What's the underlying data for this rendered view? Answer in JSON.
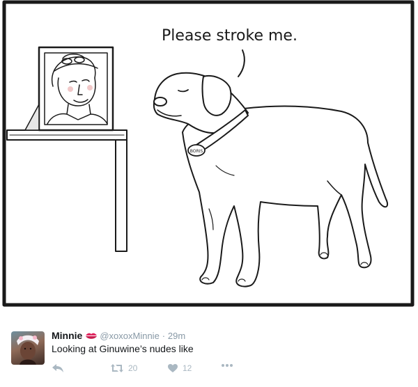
{
  "comic": {
    "speech": "Please stroke me.",
    "collar_tag": "BORIS"
  },
  "tweet": {
    "author_name": "Minnie",
    "handle": "@xoxoxMinnie",
    "separator": "·",
    "time": "29m",
    "text": "Looking at Ginuwine’s nudes like",
    "retweets": "20",
    "likes": "12",
    "icons": {
      "badge": "kiss-lips-icon",
      "reply": "reply-icon",
      "retweet": "retweet-icon",
      "like": "heart-icon",
      "more": "more-icon"
    },
    "colors": {
      "name": "#14171a",
      "meta": "#8899a6",
      "action": "#aab8c2",
      "lips": "#e0245e"
    }
  }
}
